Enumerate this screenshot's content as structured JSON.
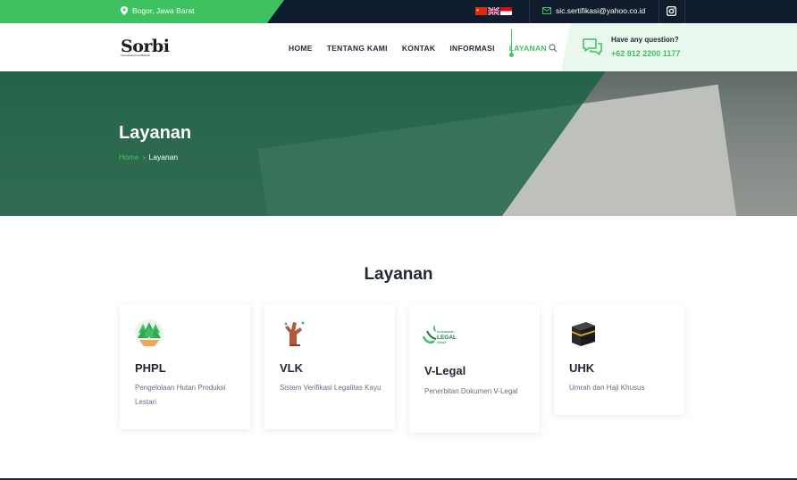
{
  "topbar": {
    "location": "Bogor, Jawa Barat",
    "email": "sic.sertifikasi@yahoo.co.id",
    "flags": [
      "china-flag-icon",
      "uk-flag-icon",
      "indonesia-flag-icon"
    ],
    "accent": "#3ec261",
    "background": "#0f1d2e"
  },
  "header": {
    "logo_text": "Sorbi",
    "logo_sub": "International Certification",
    "nav": [
      "HOME",
      "TENTANG KAMI",
      "KONTAK",
      "INFORMASI",
      "LAYANAN"
    ],
    "active_nav": "LAYANAN",
    "question_title": "Have any question?",
    "question_phone": "+62 812 2200 1177"
  },
  "hero": {
    "title": "Layanan",
    "breadcrumb_home": "Home",
    "breadcrumb_sep": "›",
    "breadcrumb_current": "Layanan"
  },
  "main": {
    "section_title": "Layanan",
    "cards": [
      {
        "title": "PHPL",
        "desc": "Pengelolaan Hutan Produksi Lestari",
        "icon": "forest-icon"
      },
      {
        "title": "VLK",
        "desc": "Sistem Verifikasi Legalitas Kayu",
        "icon": "tree-stump-icon"
      },
      {
        "title": "V-Legal",
        "desc": "Penerbitan Dokumen V-Legal",
        "icon": "indonesian-legal-wood-logo-icon"
      },
      {
        "title": "UHK",
        "desc": "Umrah dan Haji Khusus",
        "icon": "kaaba-icon"
      }
    ]
  }
}
